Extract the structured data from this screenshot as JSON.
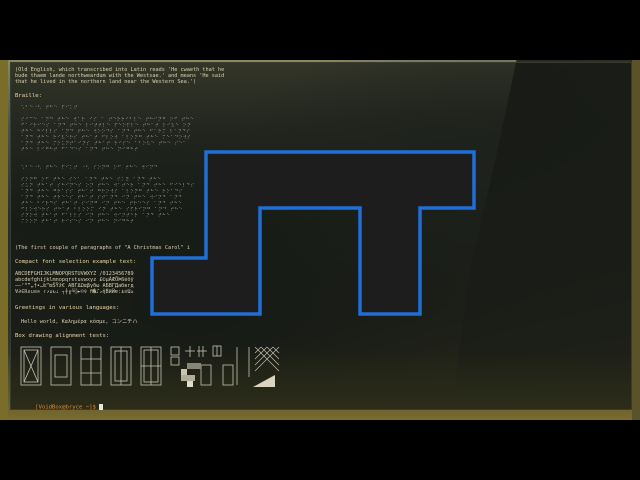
{
  "terminal": {
    "oldenglish_lines": [
      "(Old English, which transcribed into Latin reads 'He cwaeth that he",
      "bude thaem lande northweardum with the Westsae.' and means 'He said",
      "that he lived in the northern land near the Western Sea.')"
    ],
    "braille_heading": "Braille:",
    "braille_blocks": [
      [
        "⠡⠃⠑⠐⠣ ⠞⠓⠑ ⠏⠊⠅⠞"
      ],
      [
        "⠎⠊⠉⠑ ⠁⠝⠙ ⠞⠓⠑ ⠺⠁⠗ ⠊⠎ ⠁ ⠞⠑⠗⠗⠊⠃⠇⠑ ⠞⠓⠊⠝⠛ ⠕⠋ ⠞⠓⠑",
        "⠋⠁⠊⠗⠊⠑⠎ ⠁⠝⠙ ⠞⠓⠑ ⠇⠊⠞⠞⠇⠑ ⠏⠑⠕⠏⠇⠑ ⠞⠓⠁⠞ ⠇⠊⠧⠑ ⠕⠝",
        "⠞⠓⠑ ⠓⠊⠇⠇⠎ ⠁⠝⠙ ⠞⠓⠑ ⠺⠕⠕⠙⠎ ⠁⠝⠙ ⠞⠓⠑ ⠋⠁⠗⠍ ⠇⠁⠝⠙⠎",
        "⠁⠝⠙ ⠞⠓⠑ ⠗⠊⠧⠑⠗⠎ ⠞⠓⠁⠞ ⠋⠇⠕⠺ ⠁⠇⠕⠝⠛ ⠞⠓⠑ ⠍⠑⠁⠙⠕⠺⠎",
        "⠁⠝⠙ ⠞⠓⠑ ⠍⠕⠥⠝⠞⠁⠊⠝⠎ ⠞⠓⠁⠞ ⠗⠊⠎⠑ ⠁⠃⠕⠧⠑ ⠞⠓⠑ ⠎⠑⠁",
        "⠞⠓⠑ ⠇⠊⠛⠓⠞ ⠋⠁⠙⠑⠎ ⠁⠝⠙ ⠞⠓⠑ ⠝⠊⠛⠓⠞"
      ],
      [
        "⠡⠃⠑⠐⠣ ⠞⠓⠑ ⠏⠊⠅⠞ ⠐⠣ ⠎⠕⠝⠛ ⠕⠋ ⠞⠓⠑ ⠺⠊⠝⠙"
      ],
      [
        "⠎⠕⠝⠛ ⠕⠋ ⠞⠓⠑ ⠎⠑⠁ ⠁⠝⠙ ⠞⠓⠑ ⠎⠅⠽ ⠁⠝⠙ ⠞⠓⠑",
        "⠎⠥⠝ ⠞⠓⠁⠞ ⠎⠓⠊⠝⠑⠎ ⠕⠝ ⠞⠓⠑ ⠺⠁⠞⠑⠗ ⠁⠝⠙ ⠞⠓⠑ ⠋⠊⠑⠇⠙⠎",
        "⠁⠝⠙ ⠞⠓⠑ ⠛⠗⠁⠎⠎ ⠞⠓⠁⠞ ⠛⠗⠕⠺⠎ ⠁⠇⠕⠝⠛ ⠞⠓⠑ ⠗⠕⠁⠙⠎",
        "⠁⠝⠙ ⠞⠓⠑ ⠞⠗⠑⠑⠎ ⠞⠓⠁⠞ ⠎⠞⠁⠝⠙ ⠊⠝ ⠞⠓⠑ ⠺⠊⠝⠙ ⠁⠝⠙",
        "⠞⠓⠑ ⠃⠊⠗⠙⠎ ⠞⠓⠁⠞ ⠎⠊⠝⠛ ⠊⠝ ⠞⠓⠑ ⠞⠗⠑⠑⠎ ⠁⠝⠙ ⠞⠓⠑",
        "⠋⠇⠕⠺⠑⠗⠎ ⠞⠓⠁⠞ ⠃⠇⠕⠕⠍ ⠊⠝ ⠞⠓⠑ ⠎⠏⠗⠊⠝⠛ ⠁⠝⠙ ⠞⠓⠑",
        "⠎⠝⠕⠺ ⠞⠓⠁⠞ ⠋⠁⠇⠇⠎ ⠊⠝ ⠞⠓⠑ ⠺⠊⠝⠞⠑⠗ ⠁⠝⠙ ⠞⠓⠑",
        "⠍⠕⠕⠝ ⠞⠓⠁⠞ ⠗⠊⠎⠑⠎ ⠊⠝ ⠞⠓⠑ ⠝⠊⠛⠓⠞"
      ]
    ],
    "christmas_carol_line": "(The first couple of paragraphs of \"A Christmas Carol\" i",
    "compact_font_heading": "Compact font selection example text:",
    "compact_font_lines": [
      "ABCDEFGHIJKLMNOPQRSTUVWXYZ /0123456789",
      "abcdefghijklmnopqrstuvwxyz £©µÀÆÖÞßéöÿ",
      "–—‘“”„†•…‰™œŠŸž€ ΑΒΓΔΩαβγδω АБВГДабвгд",
      "∀∂∈ℝ∧∪≡∞ ↑↗↨↻⇣ ┐┼╔╘░►☺♀ ﬁ�⑀₂ἠḂӥẄɐː⍎אԱა"
    ],
    "greetings_heading": "Greetings in various languages:",
    "greetings_line": "Hello world, Καλημέρα κόσμε, コンニチハ",
    "box_heading": "Box drawing alignment tests:",
    "prompt": {
      "user_host": "[VoidBox@bryce ~]$ "
    }
  },
  "logo": {
    "color": "#1f6fd6",
    "fill": "#1d1d1d"
  }
}
